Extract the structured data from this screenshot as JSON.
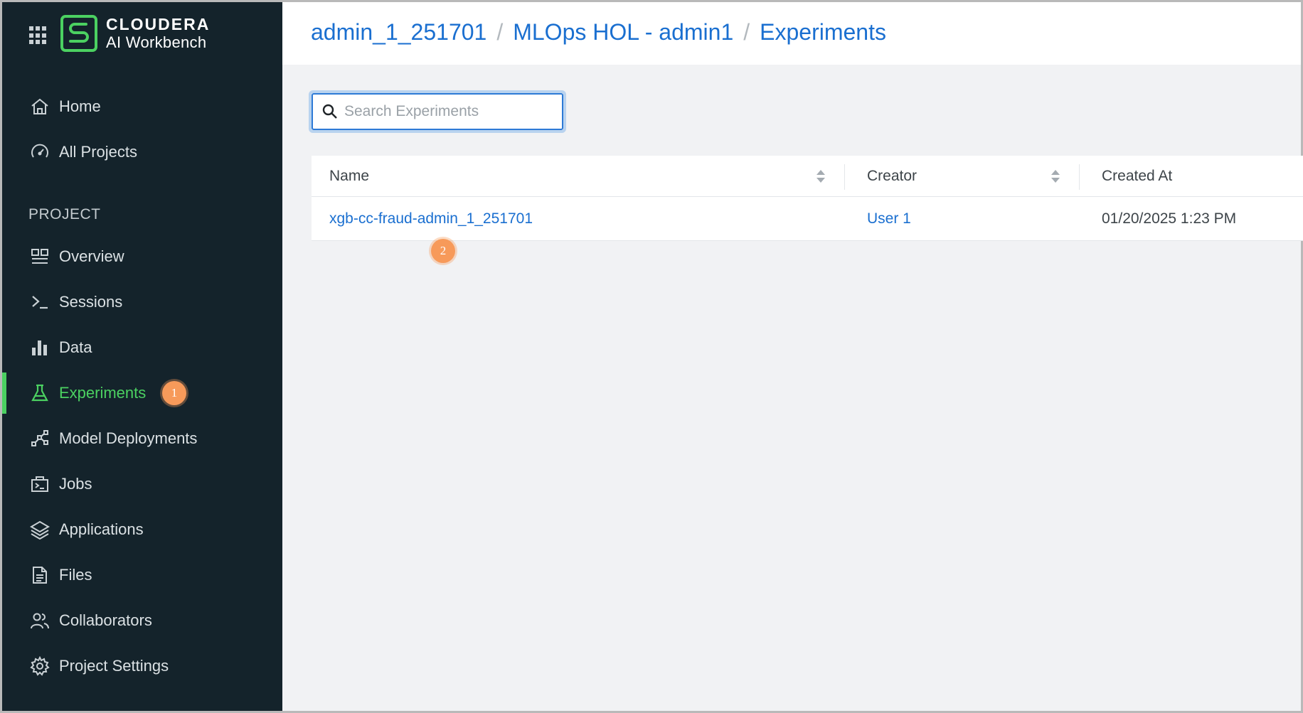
{
  "brand": {
    "name": "CLOUDERA",
    "product": "AI Workbench",
    "accent": "#4bd161"
  },
  "sidebar": {
    "items": [
      {
        "label": "Home",
        "icon": "home-icon"
      },
      {
        "label": "All Projects",
        "icon": "gauge-icon"
      }
    ],
    "section_label": "PROJECT",
    "project_items": [
      {
        "label": "Overview",
        "icon": "dashboard-icon"
      },
      {
        "label": "Sessions",
        "icon": "terminal-icon"
      },
      {
        "label": "Data",
        "icon": "bar-chart-icon"
      },
      {
        "label": "Experiments",
        "icon": "flask-icon",
        "active": true
      },
      {
        "label": "Model Deployments",
        "icon": "network-icon"
      },
      {
        "label": "Jobs",
        "icon": "jobs-icon"
      },
      {
        "label": "Applications",
        "icon": "layers-icon"
      },
      {
        "label": "Files",
        "icon": "file-icon"
      },
      {
        "label": "Collaborators",
        "icon": "users-icon"
      },
      {
        "label": "Project Settings",
        "icon": "gear-icon"
      }
    ]
  },
  "breadcrumb": {
    "items": [
      "admin_1_251701",
      "MLOps HOL - admin1",
      "Experiments"
    ],
    "separator": "/"
  },
  "search": {
    "placeholder": "Search Experiments",
    "value": ""
  },
  "table": {
    "columns": [
      "Name",
      "Creator",
      "Created At"
    ],
    "rows": [
      {
        "name": "xgb-cc-fraud-admin_1_251701",
        "creator": "User 1",
        "created_at": "01/20/2025 1:23 PM"
      }
    ]
  },
  "annotations": {
    "step1": "1",
    "step2": "2",
    "color": "#f79a5a"
  }
}
